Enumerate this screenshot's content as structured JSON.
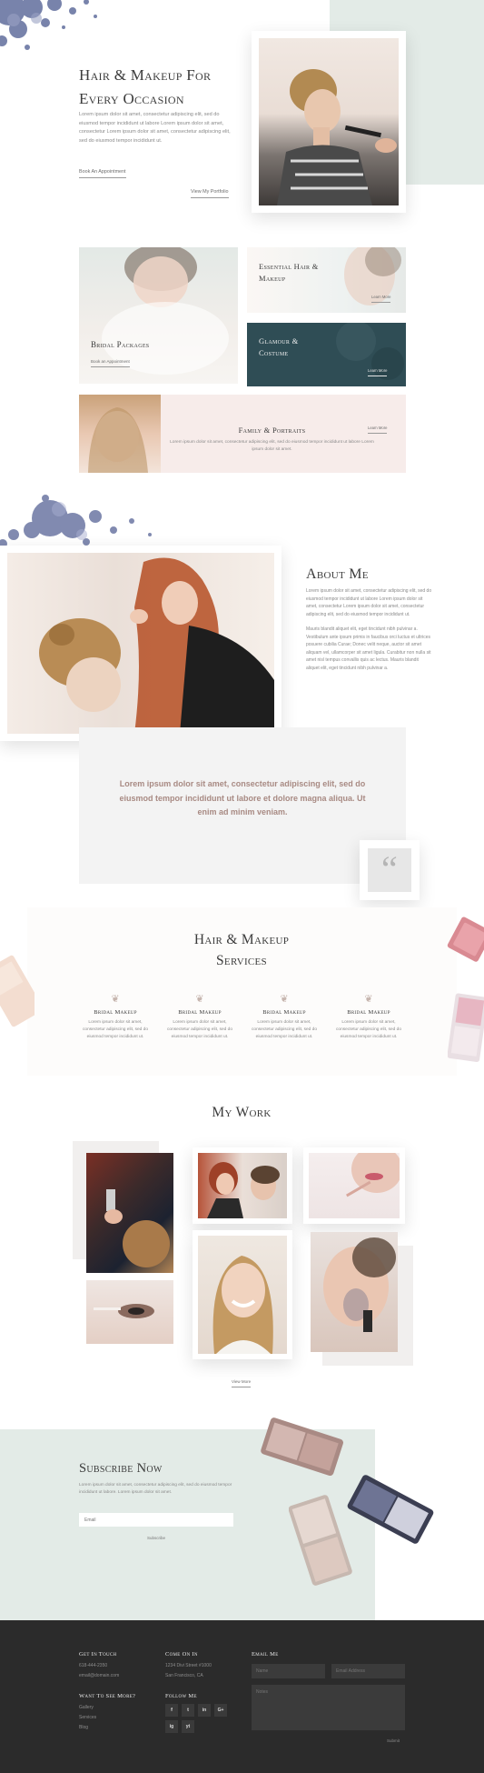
{
  "hero": {
    "title_line1": "Hair & Makeup For",
    "title_line2": "Every Occasion",
    "text": "Lorem ipsum dolor sit amet, consectetur adipiscing elit, sed do eiusmod tempor incididunt ut labore Lorem ipsum dolor sit amet, consectetur Lorem ipsum dolor sit amet, consectetur adipiscing elit, sed do eiusmod tempor incididunt ut.",
    "book_label": "Book An Appointment",
    "portfolio_label": "View My Portfolio"
  },
  "packages": {
    "bridal": {
      "title": "Bridal Packages",
      "link": "Book an Appointment"
    },
    "essential": {
      "title_line1": "Essential Hair &",
      "title_line2": "Makeup",
      "link": "Learn More"
    },
    "glamour": {
      "title_line1": "Glamour &",
      "title_line2": "Costume",
      "link": "Learn More"
    },
    "family": {
      "title": "Family & Portraits",
      "text": "Lorem ipsum dolor sit amet, consectetur adipiscing elit, sed do eiusmod tempor incididunt ut labore Lorem ipsum dolor sit amet.",
      "link": "Learn More"
    }
  },
  "about": {
    "title": "About Me",
    "p1": "Lorem ipsum dolor sit amet, consectetur adipiscing elit, sed do eiusmod tempor incididunt ut labore Lorem ipsum dolor sit amet, consectetur Lorem ipsum dolor sit amet, consectetur adipiscing elit, sed do eiusmod tempor incididunt ut.",
    "p2": "Mauris blandit aliquet elit, eget tincidunt nibh pulvinar a. Vestibulum ante ipsum primis in faucibus orci luctus et ultrices posuere cubilia Curae; Donec velit neque, auctor sit amet aliquam vel, ullamcorper sit amet ligula. Curabitur non nulla sit amet nisl tempus convallis quis ac lectus. Mauris blandit aliquet elit, eget tincidunt nibh pulvinar a."
  },
  "quote": {
    "text": "Lorem ipsum dolor sit amet, consectetur adipiscing elit, sed do eiusmod tempor incididunt ut labore et dolore magna aliqua. Ut enim ad minim veniam.",
    "mark": "“"
  },
  "services": {
    "title_line1": "Hair & Makeup",
    "title_line2": "Services",
    "items": [
      {
        "title": "Bridal Makeup",
        "text": "Lorem ipsum dolor sit amet, consectetur adipiscing elit, sed do eiusmod tempor incididunt ut."
      },
      {
        "title": "Bridal Makeup",
        "text": "Lorem ipsum dolor sit amet, consectetur adipiscing elit, sed do eiusmod tempor incididunt ut."
      },
      {
        "title": "Bridal Makeup",
        "text": "Lorem ipsum dolor sit amet, consectetur adipiscing elit, sed do eiusmod tempor incididunt ut."
      },
      {
        "title": "Bridal Makeup",
        "text": "Lorem ipsum dolor sit amet, consectetur adipiscing elit, sed do eiusmod tempor incididunt ut."
      }
    ]
  },
  "work": {
    "title": "My Work",
    "link": "View More"
  },
  "subscribe": {
    "title": "Subscribe Now",
    "text": "Lorem ipsum dolor sit amet, consectetur adipiscing elit, sed do eiusmod tempor incididunt ut labore. Lorem ipsum dolor sit amet.",
    "email_placeholder": "Email",
    "button": "Subscribe"
  },
  "footer": {
    "touch_title": "Get In Touch",
    "phone": "618-444-2350",
    "email": "email@domain.com",
    "come_title": "Come On In",
    "address1": "1234 Divi Street #1000",
    "address2": "San Francisco, CA",
    "more_title": "Want To See More?",
    "links": [
      "Gallery",
      "Services",
      "Blog"
    ],
    "follow_title": "Follow Me",
    "social": [
      "f",
      "t",
      "in",
      "G+",
      "ig",
      "yt"
    ],
    "email_me_title": "Email Me",
    "name_placeholder": "Name",
    "email_placeholder": "Email Address",
    "notes_placeholder": "Notes",
    "submit": "Submit"
  },
  "colors": {
    "mint": "#e3ebe7",
    "teal": "#2f4d55",
    "blush": "#f7ecea",
    "grey": "#f3f3f3",
    "dark": "#2b2b2b",
    "quote_text": "#a88a83"
  }
}
